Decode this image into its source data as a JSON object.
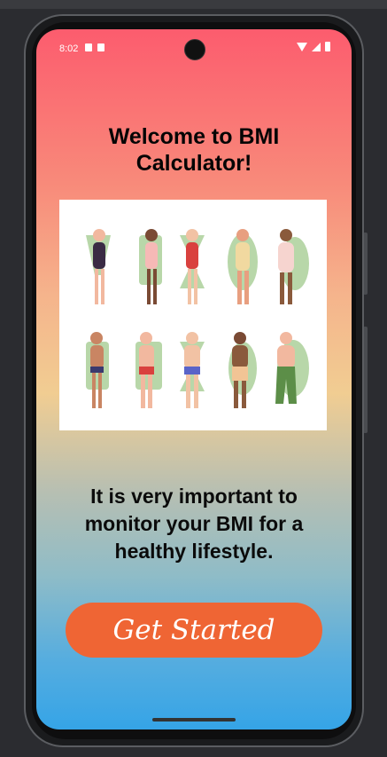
{
  "status_bar": {
    "time": "8:02"
  },
  "welcome": {
    "title": "Welcome to BMI Calculator!"
  },
  "illustration": {
    "alt": "body-types-illustration"
  },
  "message": {
    "text": "It is very important to monitor your BMI for a healthy lifestyle."
  },
  "cta": {
    "label": "Get Started"
  },
  "colors": {
    "gradient_top": "#fc5c6e",
    "gradient_middle": "#f1cd92",
    "gradient_bottom": "#35a4e7",
    "button": "#ef6534"
  }
}
